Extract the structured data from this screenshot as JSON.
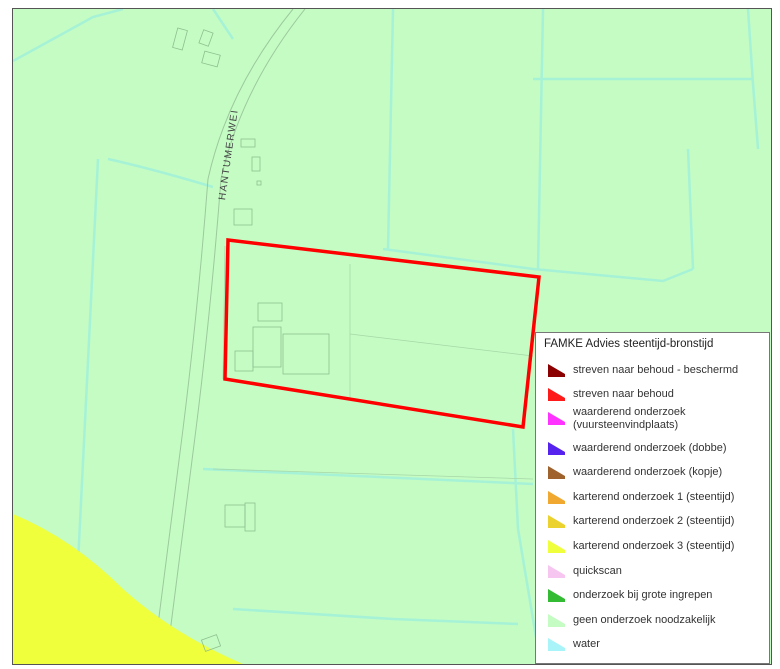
{
  "map": {
    "road_name": "HANTUMERWEI",
    "colors": {
      "background": "#c4fcc4",
      "water": "#a6f5d9",
      "yellow_zone": "#f0ff3c",
      "parcel_outline": "#ff0000",
      "parcel_lines": "#8fcf8f"
    }
  },
  "legend": {
    "title": "FAMKE Advies steentijd-bronstijd",
    "items": [
      {
        "label": "streven naar behoud - beschermd",
        "color": "#8b0000"
      },
      {
        "label": "streven naar behoud",
        "color": "#ff1a1a"
      },
      {
        "label": "waarderend onderzoek\n(vuursteenvindplaats)",
        "color": "#ff33ff"
      },
      {
        "label": "waarderend onderzoek (dobbe)",
        "color": "#5522ee"
      },
      {
        "label": "waarderend onderzoek (kopje)",
        "color": "#a0622d"
      },
      {
        "label": "karterend onderzoek 1 (steentijd)",
        "color": "#f0a830"
      },
      {
        "label": "karterend onderzoek 2 (steentijd)",
        "color": "#ecd22e"
      },
      {
        "label": "karterend onderzoek 3 (steentijd)",
        "color": "#f0ff3c"
      },
      {
        "label": "quickscan",
        "color": "#f7c6f0"
      },
      {
        "label": "onderzoek bij grote ingrepen",
        "color": "#33bb33"
      },
      {
        "label": "geen onderzoek noodzakelijk",
        "color": "#c4fcc4"
      },
      {
        "label": "water",
        "color": "#a8f4f8"
      }
    ]
  }
}
